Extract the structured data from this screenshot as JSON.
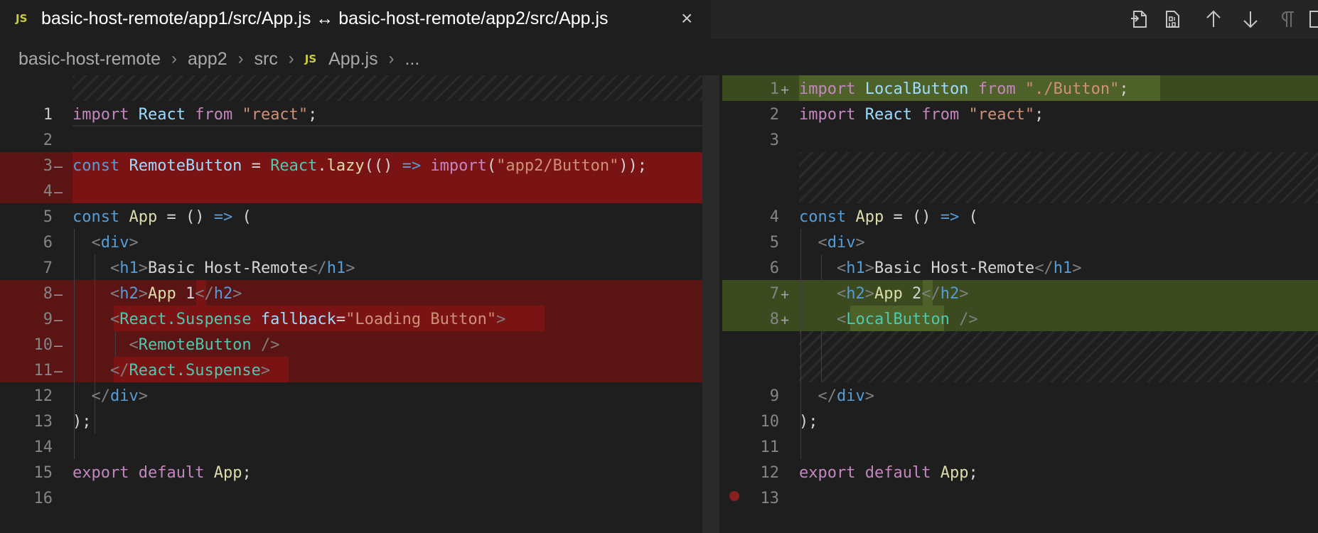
{
  "tab": {
    "badge": "JS",
    "title": "basic-host-remote/app1/src/App.js ↔ basic-host-remote/app2/src/App.js",
    "close": "×"
  },
  "toolbar": {
    "icons": [
      "open-file-icon",
      "binary-diff-icon",
      "previous-change-icon",
      "next-change-icon",
      "whitespace-toggle-icon",
      "split-editor-icon"
    ]
  },
  "breadcrumb": {
    "items": [
      "basic-host-remote",
      "app2",
      "src"
    ],
    "file_badge": "JS",
    "file": "App.js",
    "more": "..."
  },
  "left": {
    "lines": [
      {
        "n": "1",
        "mark": "",
        "text": "import React from \"react\";"
      },
      {
        "n": "2",
        "mark": "",
        "text": ""
      },
      {
        "n": "3",
        "mark": "—",
        "text": "const RemoteButton = React.lazy(() => import(\"app2/Button\"));"
      },
      {
        "n": "4",
        "mark": "—",
        "text": ""
      },
      {
        "n": "5",
        "mark": "",
        "text": "const App = () => ("
      },
      {
        "n": "6",
        "mark": "",
        "text": "  <div>"
      },
      {
        "n": "7",
        "mark": "",
        "text": "    <h1>Basic Host-Remote</h1>"
      },
      {
        "n": "8",
        "mark": "—",
        "text": "    <h2>App 1</h2>"
      },
      {
        "n": "9",
        "mark": "—",
        "text": "    <React.Suspense fallback=\"Loading Button\">"
      },
      {
        "n": "10",
        "mark": "—",
        "text": "      <RemoteButton />"
      },
      {
        "n": "11",
        "mark": "—",
        "text": "    </React.Suspense>"
      },
      {
        "n": "12",
        "mark": "",
        "text": "  </div>"
      },
      {
        "n": "13",
        "mark": "",
        "text": ");"
      },
      {
        "n": "14",
        "mark": "",
        "text": ""
      },
      {
        "n": "15",
        "mark": "",
        "text": "export default App;"
      },
      {
        "n": "16",
        "mark": "",
        "text": ""
      }
    ]
  },
  "right": {
    "lines": [
      {
        "n": "1",
        "mark": "+",
        "text": "import LocalButton from \"./Button\";"
      },
      {
        "n": "2",
        "mark": "",
        "text": "import React from \"react\";"
      },
      {
        "n": "3",
        "mark": "",
        "text": ""
      },
      {
        "n": "4",
        "mark": "",
        "text": "const App = () => ("
      },
      {
        "n": "5",
        "mark": "",
        "text": "  <div>"
      },
      {
        "n": "6",
        "mark": "",
        "text": "    <h1>Basic Host-Remote</h1>"
      },
      {
        "n": "7",
        "mark": "+",
        "text": "    <h2>App 2</h2>"
      },
      {
        "n": "8",
        "mark": "+",
        "text": "    <LocalButton />"
      },
      {
        "n": "9",
        "mark": "",
        "text": "  </div>"
      },
      {
        "n": "10",
        "mark": "",
        "text": ");"
      },
      {
        "n": "11",
        "mark": "",
        "text": ""
      },
      {
        "n": "12",
        "mark": "",
        "text": "export default App;"
      },
      {
        "n": "13",
        "mark": "",
        "text": ""
      }
    ]
  },
  "colors": {
    "deleted_line": "#5a1414",
    "deleted_text": "#7a1313",
    "inserted_line": "#3b4a1f",
    "inserted_text": "#4d6128",
    "breakpoint": "#8a1f1f"
  }
}
